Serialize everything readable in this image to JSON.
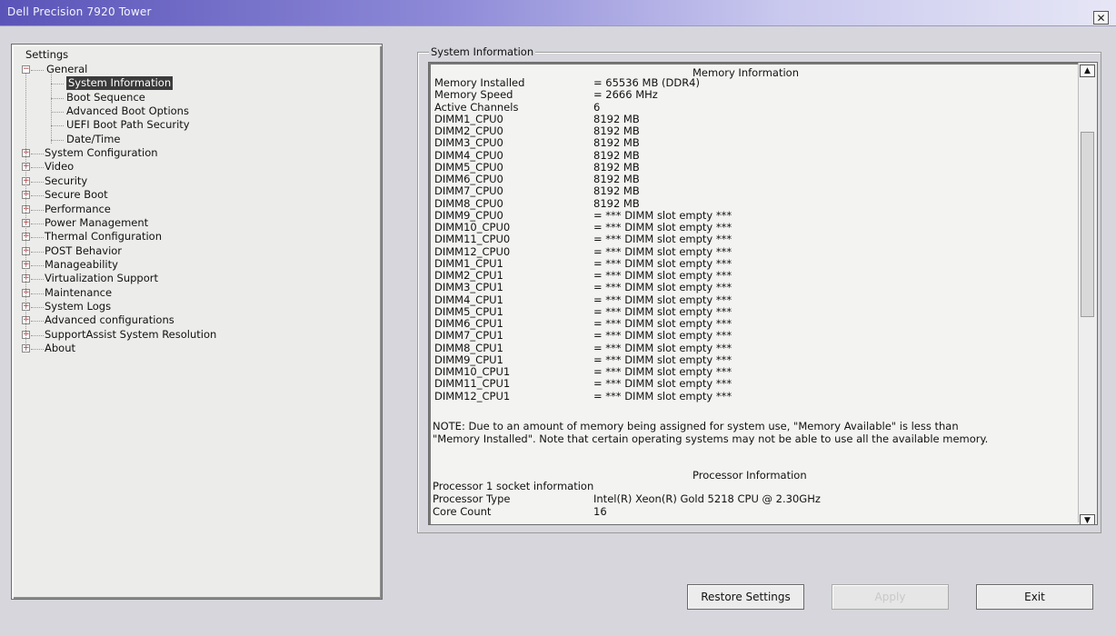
{
  "window": {
    "title": "Dell Precision 7920 Tower",
    "close_label": "✕"
  },
  "tree": {
    "root": "Settings",
    "general": {
      "label": "General",
      "children": [
        "System Information",
        "Boot Sequence",
        "Advanced Boot Options",
        "UEFI Boot Path Security",
        "Date/Time"
      ]
    },
    "items": [
      "System Configuration",
      "Video",
      "Security",
      "Secure Boot",
      "Performance",
      "Power Management",
      "Thermal Configuration",
      "POST Behavior",
      "Manageability",
      "Virtualization Support",
      "Maintenance",
      "System Logs",
      "Advanced configurations",
      "SupportAssist System Resolution",
      "About"
    ]
  },
  "panel": {
    "legend": "System Information",
    "memory_heading": "Memory Information",
    "memory_rows": [
      [
        "Memory Installed",
        "= 65536 MB (DDR4)"
      ],
      [
        "Memory Speed",
        "= 2666 MHz"
      ],
      [
        "Active Channels",
        "6"
      ],
      [
        "DIMM1_CPU0",
        "8192 MB"
      ],
      [
        "DIMM2_CPU0",
        "8192 MB"
      ],
      [
        "DIMM3_CPU0",
        "8192 MB"
      ],
      [
        "DIMM4_CPU0",
        "8192 MB"
      ],
      [
        "DIMM5_CPU0",
        "8192 MB"
      ],
      [
        "DIMM6_CPU0",
        "8192 MB"
      ],
      [
        "DIMM7_CPU0",
        "8192 MB"
      ],
      [
        "DIMM8_CPU0",
        "8192 MB"
      ],
      [
        "DIMM9_CPU0",
        "= *** DIMM slot empty ***"
      ],
      [
        "DIMM10_CPU0",
        "= *** DIMM slot empty ***"
      ],
      [
        "DIMM11_CPU0",
        "= *** DIMM slot empty ***"
      ],
      [
        "DIMM12_CPU0",
        "= *** DIMM slot empty ***"
      ],
      [
        "DIMM1_CPU1",
        "= *** DIMM slot empty ***"
      ],
      [
        "DIMM2_CPU1",
        "= *** DIMM slot empty ***"
      ],
      [
        "DIMM3_CPU1",
        "= *** DIMM slot empty ***"
      ],
      [
        "DIMM4_CPU1",
        "= *** DIMM slot empty ***"
      ],
      [
        "DIMM5_CPU1",
        "= *** DIMM slot empty ***"
      ],
      [
        "DIMM6_CPU1",
        "= *** DIMM slot empty ***"
      ],
      [
        "DIMM7_CPU1",
        "= *** DIMM slot empty ***"
      ],
      [
        "DIMM8_CPU1",
        "= *** DIMM slot empty ***"
      ],
      [
        "DIMM9_CPU1",
        "= *** DIMM slot empty ***"
      ],
      [
        "DIMM10_CPU1",
        "= *** DIMM slot empty ***"
      ],
      [
        "DIMM11_CPU1",
        "= *** DIMM slot empty ***"
      ],
      [
        "DIMM12_CPU1",
        "= *** DIMM slot empty ***"
      ]
    ],
    "note": "NOTE: Due to an amount of memory being assigned for system use, \"Memory Available\" is less than \"Memory Installed\". Note that certain operating systems may not be able to use all the available memory.",
    "processor_heading": "Processor Information",
    "processor_socket": "Processor 1 socket information",
    "processor_rows": [
      [
        "Processor Type",
        "Intel(R) Xeon(R) Gold 5218 CPU @ 2.30GHz"
      ],
      [
        "Core Count",
        "16"
      ]
    ],
    "scroll_up": "▲",
    "scroll_down": "▼"
  },
  "buttons": {
    "restore": "Restore Settings",
    "apply": "Apply",
    "exit": "Exit"
  }
}
